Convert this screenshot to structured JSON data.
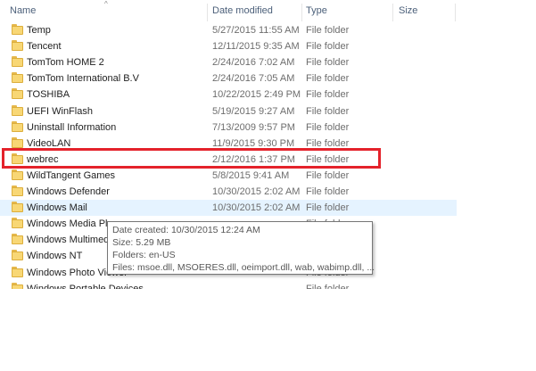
{
  "columns": {
    "name": "Name",
    "date_modified": "Date modified",
    "type": "Type",
    "size": "Size"
  },
  "rows": [
    {
      "name": "Temp",
      "date": "5/27/2015 11:55 AM",
      "type": "File folder"
    },
    {
      "name": "Tencent",
      "date": "12/11/2015 9:35 AM",
      "type": "File folder"
    },
    {
      "name": "TomTom HOME 2",
      "date": "2/24/2016 7:02 AM",
      "type": "File folder"
    },
    {
      "name": "TomTom International B.V",
      "date": "2/24/2016 7:05 AM",
      "type": "File folder"
    },
    {
      "name": "TOSHIBA",
      "date": "10/22/2015 2:49 PM",
      "type": "File folder"
    },
    {
      "name": "UEFI WinFlash",
      "date": "5/19/2015 9:27 AM",
      "type": "File folder"
    },
    {
      "name": "Uninstall Information",
      "date": "7/13/2009 9:57 PM",
      "type": "File folder"
    },
    {
      "name": "VideoLAN",
      "date": "11/9/2015 9:30 PM",
      "type": "File folder"
    },
    {
      "name": "webrec",
      "date": "2/12/2016 1:37 PM",
      "type": "File folder"
    },
    {
      "name": "WildTangent Games",
      "date": "5/8/2015 9:41 AM",
      "type": "File folder"
    },
    {
      "name": "Windows Defender",
      "date": "10/30/2015 2:02 AM",
      "type": "File folder"
    },
    {
      "name": "Windows Mail",
      "date": "10/30/2015 2:02 AM",
      "type": "File folder"
    },
    {
      "name": "Windows Media Player",
      "date": "",
      "type": "File folder"
    },
    {
      "name": "Windows Multimedia Platform",
      "date": "",
      "type": "File folder"
    },
    {
      "name": "Windows NT",
      "date": "",
      "type": "File folder"
    },
    {
      "name": "Windows Photo Viewer",
      "date": "",
      "type": "File folder"
    },
    {
      "name": "Windows Portable Devices",
      "date": "",
      "type": "File folder"
    }
  ],
  "tooltip": {
    "date_created": "Date created: 10/30/2015 12:24 AM",
    "size": "Size: 5.29 MB",
    "folders": "Folders: en-US",
    "files": "Files: msoe.dll, MSOERES.dll, oeimport.dll, wab, wabimp.dll, ..."
  },
  "colors": {
    "highlight_border": "#e4222b",
    "hover_row": "#e5f3ff",
    "folder_icon": "#f8d775"
  },
  "icons": {
    "row_icon": "folder-icon",
    "header_glyph": "sort-indicator-icon"
  }
}
